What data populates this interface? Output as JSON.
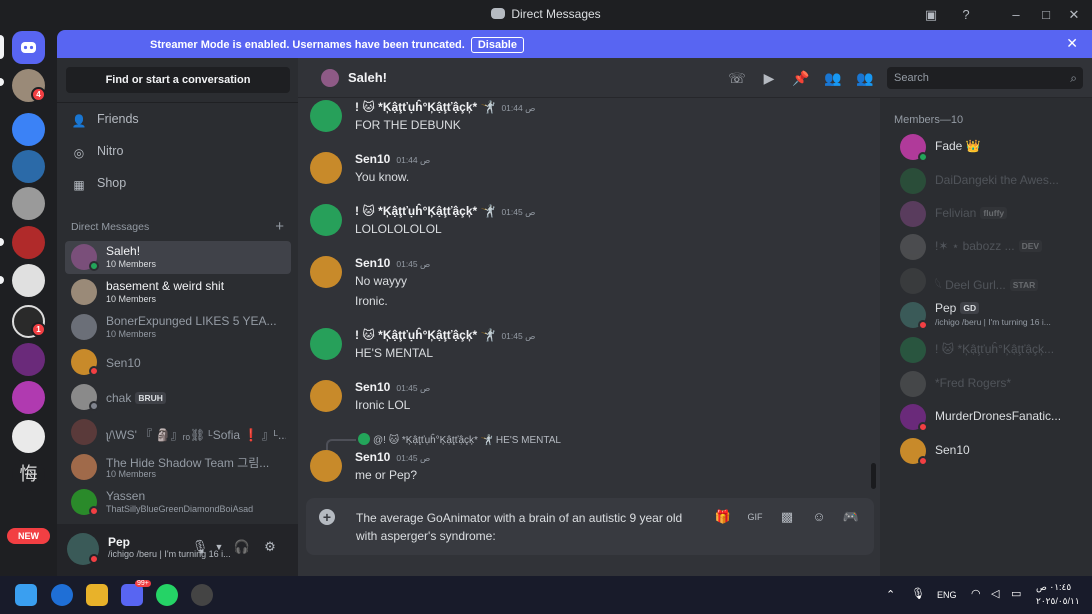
{
  "window": {
    "title": "Direct Messages"
  },
  "banner": {
    "text": "Streamer Mode is enabled. Usernames have been truncated.",
    "button": "Disable"
  },
  "sidebar": {
    "find": "Find or start a conversation",
    "nav": [
      {
        "label": "Friends",
        "icon": "friends-icon"
      },
      {
        "label": "Nitro",
        "icon": "nitro-icon"
      },
      {
        "label": "Shop",
        "icon": "shop-icon"
      }
    ],
    "dm_header": "Direct Messages",
    "dms": [
      {
        "name": "Saleh!",
        "sub": "10 Members",
        "color": "#7a4f7a",
        "active": true
      },
      {
        "name": "basement & weird shit",
        "sub": "10 Members",
        "color": "#9a8a78"
      },
      {
        "name": "BonerExpunged LIKES 5 YEA...",
        "sub": "10 Members",
        "color": "#6b6f78"
      },
      {
        "name": "Sen10",
        "sub": "",
        "color": "#c88a2a"
      },
      {
        "name": "chak",
        "sub": "",
        "tag": "BRUH",
        "color": "#8a8a8a"
      },
      {
        "name": "ʅ/\\WS' 『 🗿』ᵣₒ⛓ ᴸSofia ❗ 』ᴸ...",
        "sub": "",
        "color": "#5a3a3a"
      },
      {
        "name": "The Hide Shadow Team 그림...",
        "sub": "10 Members",
        "color": "#a06a4a"
      },
      {
        "name": "Yassen",
        "sub": "ThatSillyBlueGreenDiamondBoiAsad",
        "color": "#2a8a2a"
      }
    ]
  },
  "user": {
    "name": "Pep",
    "status": "/ichigo /beru | I'm turning 16 i..."
  },
  "chat": {
    "channel": "Saleh!",
    "search_placeholder": "Search",
    "messages": [
      {
        "author": "! 🐱 *Ķậţťụĥ°Ķậţťậçķ* 🤺",
        "time": "01:44 ص",
        "lines": [
          "FOR THE DEBUNK"
        ],
        "color": "#27a05a"
      },
      {
        "author": "Sen10",
        "time": "01:44 ص",
        "lines": [
          "You know."
        ],
        "color": "#c88a2a"
      },
      {
        "author": "! 🐱 *Ķậţťụĥ°Ķậţťậçķ* 🤺",
        "time": "01:45 ص",
        "lines": [
          "LOLOLOLOLOL"
        ],
        "color": "#27a05a"
      },
      {
        "author": "Sen10",
        "time": "01:45 ص",
        "lines": [
          "No wayyy",
          "Ironic."
        ],
        "color": "#c88a2a"
      },
      {
        "author": "! 🐱 *Ķậţťụĥ°Ķậţťậçķ* 🤺",
        "time": "01:45 ص",
        "lines": [
          "HE'S MENTAL"
        ],
        "color": "#27a05a"
      },
      {
        "author": "Sen10",
        "time": "01:45 ص",
        "lines": [
          "Ironic LOL"
        ],
        "color": "#c88a2a"
      },
      {
        "author": "Sen10",
        "time": "01:45 ص",
        "lines": [
          "me or Pep?"
        ],
        "color": "#c88a2a"
      }
    ],
    "reply": {
      "author": "@! 🐱 *Ķậţťụĥ°Ķậţťậçķ* 🤺",
      "text": "HE'S MENTAL"
    },
    "composer_text": "The average GoAnimator with a brain of an autistic 9 year old with asperger's syndrome:"
  },
  "members": {
    "header": "Members—10",
    "list": [
      {
        "name": "Fade 👑",
        "sub": "",
        "color": "#b03a9a",
        "dim": false
      },
      {
        "name": "DaiDangeki the Awes...",
        "sub": "",
        "color": "#2a8a4a",
        "dim": true
      },
      {
        "name": "Felivian",
        "tag": "fluffy",
        "sub": "",
        "color": "#b05ab0",
        "dim": true
      },
      {
        "name": "!✶ ⋆ babozz ...",
        "tag": "DEV",
        "sub": "",
        "color": "#888",
        "dim": true
      },
      {
        "name": "𓆩 Deel Gurl...",
        "tag": "STAR",
        "sub": "",
        "color": "#555",
        "dim": true
      },
      {
        "name": "Pep",
        "tag": "GD",
        "sub": "/ichigo /beru | I'm turning 16 i...",
        "color": "#3a5a58",
        "dim": false
      },
      {
        "name": "! 🐱 *Ķậţťụĥ°Ķậţťậçķ...",
        "sub": "",
        "color": "#27a05a",
        "dim": true
      },
      {
        "name": "*Fred Rogers*",
        "sub": "",
        "color": "#777",
        "dim": true
      },
      {
        "name": "MurderDronesFanatic...",
        "sub": "",
        "color": "#6a2a7a",
        "dim": false
      },
      {
        "name": "Sen10",
        "sub": "",
        "color": "#c88a2a",
        "dim": false
      }
    ]
  },
  "taskbar": {
    "lang": "ENG",
    "time": "٠١:٤٥ ص",
    "date": "٢٠٢٥/٠٥/١١",
    "discord_badge": "99+"
  },
  "servers": {
    "new_badge": "NEW"
  }
}
